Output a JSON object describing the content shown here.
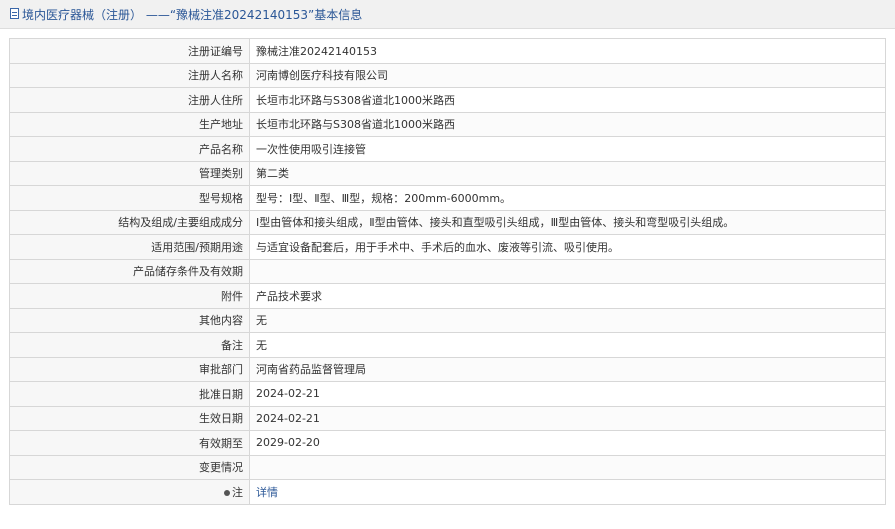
{
  "header": {
    "icon": "document-icon",
    "title": "境内医疗器械（注册） ——“豫械注准20242140153”基本信息"
  },
  "rows": [
    {
      "label": "注册证编号",
      "value": "豫械注准20242140153"
    },
    {
      "label": "注册人名称",
      "value": "河南博创医疗科技有限公司"
    },
    {
      "label": "注册人住所",
      "value": "长垣市北环路与S308省道北1000米路西"
    },
    {
      "label": "生产地址",
      "value": "长垣市北环路与S308省道北1000米路西"
    },
    {
      "label": "产品名称",
      "value": "一次性使用吸引连接管"
    },
    {
      "label": "管理类别",
      "value": "第二类"
    },
    {
      "label": "型号规格",
      "value": "型号：Ⅰ型、Ⅱ型、Ⅲ型，规格：200mm-6000mm。"
    },
    {
      "label": "结构及组成/主要组成成分",
      "value": "Ⅰ型由管体和接头组成，Ⅱ型由管体、接头和直型吸引头组成，Ⅲ型由管体、接头和弯型吸引头组成。"
    },
    {
      "label": "适用范围/预期用途",
      "value": "与适宜设备配套后，用于手术中、手术后的血水、废液等引流、吸引使用。"
    },
    {
      "label": "产品储存条件及有效期",
      "value": ""
    },
    {
      "label": "附件",
      "value": "产品技术要求"
    },
    {
      "label": "其他内容",
      "value": "无"
    },
    {
      "label": "备注",
      "value": "无"
    },
    {
      "label": "审批部门",
      "value": "河南省药品监督管理局"
    },
    {
      "label": "批准日期",
      "value": "2024-02-21"
    },
    {
      "label": "生效日期",
      "value": "2024-02-21"
    },
    {
      "label": "有效期至",
      "value": "2029-02-20"
    },
    {
      "label": "变更情况",
      "value": ""
    }
  ],
  "note_row": {
    "icon": "pin-icon",
    "label": "注",
    "link_text": "详情"
  },
  "colors": {
    "link": "#2b5797",
    "label_bg": "#f7f7f7",
    "border": "#d7d7d7",
    "header_bg": "#f1f1f1"
  }
}
